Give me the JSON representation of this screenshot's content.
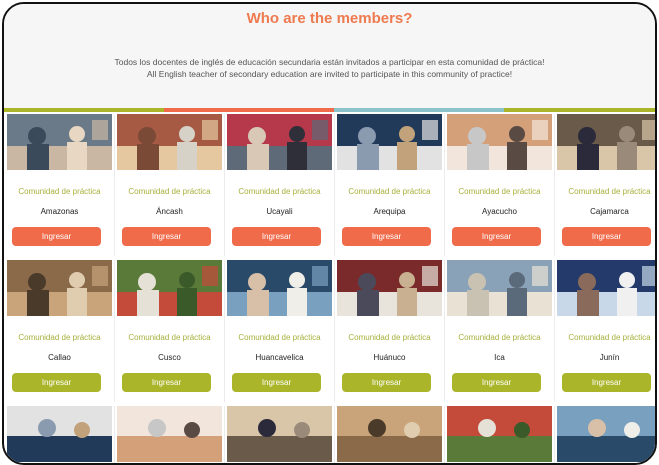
{
  "section": {
    "title": "Who are the members?",
    "description_es": "Todos los docentes de inglés de educación secundaria están invitados a participar en esta comunidad de práctica!",
    "description_en": "All English teacher of secondary education are invited to participate in this community of practice!"
  },
  "stripe_colors": [
    "#aab52a",
    "#ef6b4a",
    "#8cc2cc",
    "#aab52a"
  ],
  "card_category": "Comunidad de práctica",
  "button_label": "Ingresar",
  "colors": {
    "orange": "#ef6b4a",
    "green": "#aab52a",
    "title": "#ee7a50"
  },
  "rows": [
    {
      "button_color": "orange",
      "regions": [
        "Amazonas",
        "Áncash",
        "Ucayali",
        "Arequipa",
        "Ayacucho",
        "Cajamarca"
      ]
    },
    {
      "button_color": "green",
      "regions": [
        "Callao",
        "Cusco",
        "Huancavelica",
        "Huánuco",
        "Ica",
        "Junín"
      ]
    }
  ]
}
